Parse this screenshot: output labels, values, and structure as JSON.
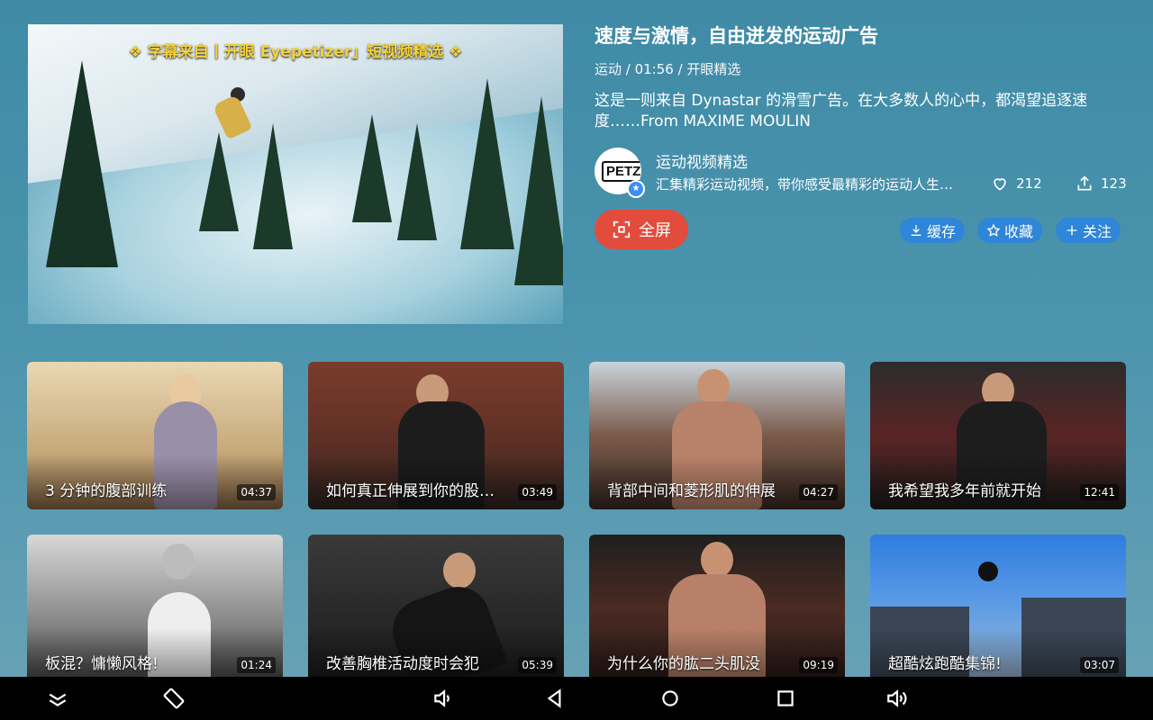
{
  "player": {
    "subtitle_banner": "❖ 字幕来自丨开眼 Eyepetizer」短视频精选 ❖"
  },
  "video": {
    "title": "速度与激情，自由迸发的运动广告",
    "meta": "运动 / 01:56 / 开眼精选",
    "description": "这是一则来自 Dynastar 的滑雪广告。在大多数人的心中，都渴望追逐速度……From MAXIME MOULIN"
  },
  "channel": {
    "avatar_text": "PETZL",
    "name": "运动视频精选",
    "description": "汇集精彩运动视频，带你感受最精彩的运动人生…",
    "likes": "212",
    "shares": "123"
  },
  "actions": {
    "fullscreen": "全屏",
    "cache": "缓存",
    "favorite": "收藏",
    "follow": "关注"
  },
  "related": [
    {
      "title": "3 分钟的腹部训练",
      "duration": "04:37"
    },
    {
      "title": "如何真正伸展到你的股…",
      "duration": "03:49"
    },
    {
      "title": "背部中间和菱形肌的伸展",
      "duration": "04:27"
    },
    {
      "title": "我希望我多年前就开始",
      "duration": "12:41"
    },
    {
      "title": "板混？慵懒风格!",
      "duration": "01:24"
    },
    {
      "title": "改善胸椎活动度时会犯",
      "duration": "05:39"
    },
    {
      "title": "为什么你的肱二头肌没",
      "duration": "09:19"
    },
    {
      "title": "超酷炫跑酷集锦!",
      "duration": "03:07"
    }
  ],
  "colors": {
    "background": "#4b94ad",
    "fullscreen_button": "#e24c3c",
    "pill_button": "#2f85d8",
    "navbar": "#000000"
  },
  "icons": {
    "navbar": [
      "collapse-icon",
      "rotate-icon",
      "volume-down-icon",
      "back-icon",
      "home-icon",
      "recents-icon",
      "volume-up-icon"
    ]
  }
}
